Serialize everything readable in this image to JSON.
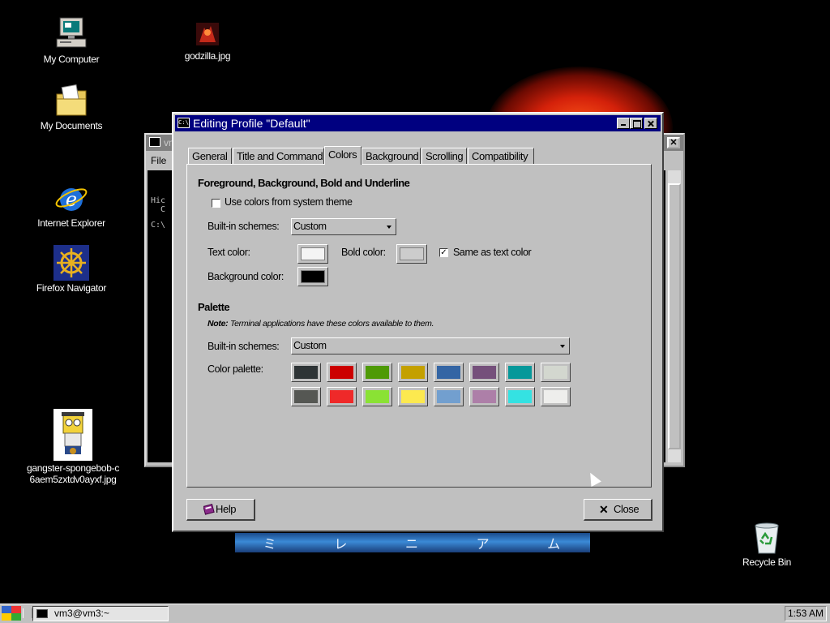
{
  "desktop": {
    "icons": [
      {
        "label": "My Computer"
      },
      {
        "label": "godzilla.jpg"
      },
      {
        "label": "My Documents"
      },
      {
        "label": "Internet Explorer"
      },
      {
        "label": "Firefox Navigator"
      },
      {
        "label": "gangster-spongebob-c6aem5zxtdv0ayxf.jpg"
      },
      {
        "label": "Recycle Bin"
      }
    ],
    "banner_text": [
      "ミ",
      "レ",
      "ニ",
      "ア",
      "ム"
    ]
  },
  "terminal_window": {
    "title": "vm",
    "menu_label": "File",
    "lines": [
      "Hic",
      "  C",
      "",
      "C:\\"
    ]
  },
  "dialog": {
    "title": "Editing Profile \"Default\"",
    "tabs": [
      {
        "label": "General"
      },
      {
        "label": "Title and Command"
      },
      {
        "label": "Colors"
      },
      {
        "label": "Background"
      },
      {
        "label": "Scrolling"
      },
      {
        "label": "Compatibility"
      }
    ],
    "active_tab": "Colors",
    "fg_section": {
      "heading": "Foreground, Background, Bold and Underline",
      "use_system_theme_label": "Use colors from system theme",
      "use_system_theme_checked": false,
      "builtin_label": "Built-in schemes:",
      "builtin_value": "Custom",
      "text_color_label": "Text color:",
      "text_color": "#f4f4f4",
      "bold_color_label": "Bold color:",
      "bold_color": "#cccccc",
      "same_as_text_label": "Same as text color",
      "same_as_text_checked": true,
      "bg_color_label": "Background color:",
      "bg_color": "#000000"
    },
    "palette_section": {
      "heading": "Palette",
      "note_prefix": "Note:",
      "note_text": " Terminal applications have these colors available to them.",
      "builtin_label": "Built-in schemes:",
      "builtin_value": "Custom",
      "palette_label": "Color palette:",
      "colors": [
        "#2e3436",
        "#cc0000",
        "#4e9a06",
        "#c4a000",
        "#3465a4",
        "#75507b",
        "#06989a",
        "#d3d7cf",
        "#555753",
        "#ef2929",
        "#8ae234",
        "#fce94f",
        "#729fcf",
        "#ad7fa8",
        "#34e2e2",
        "#eeeeec"
      ]
    },
    "help_label": "Help",
    "close_label": "Close"
  },
  "taskbar": {
    "task_label": "vm3@vm3:~",
    "clock": "1:53 AM"
  }
}
